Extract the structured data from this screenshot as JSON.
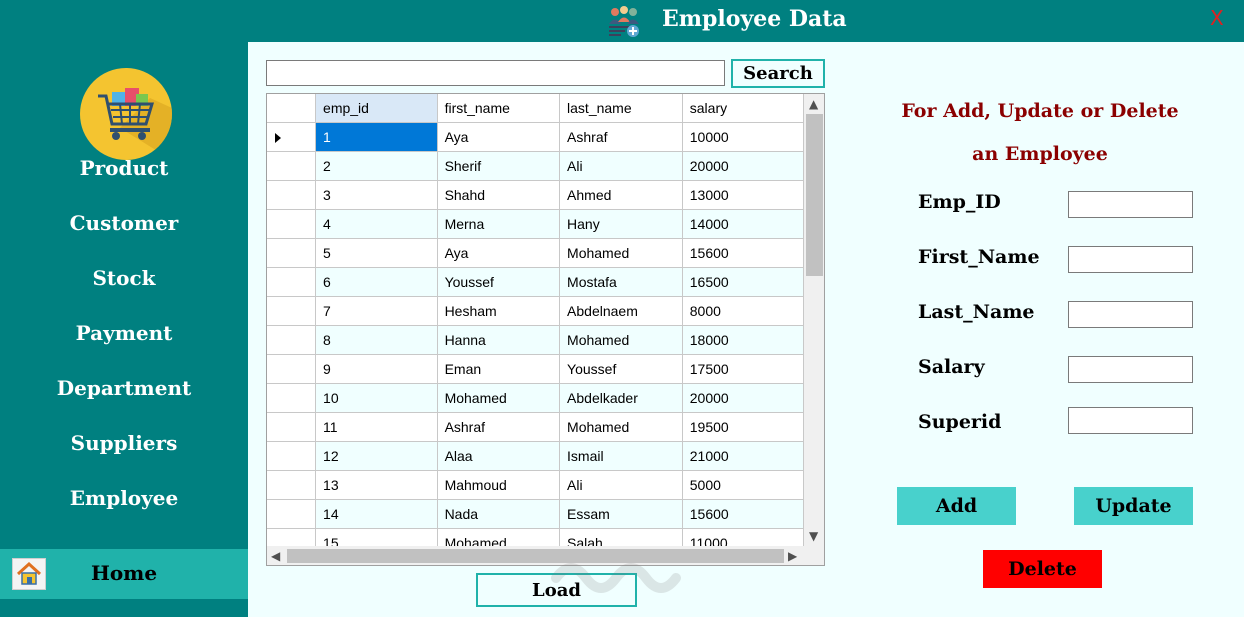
{
  "window": {
    "title": "Employee Data",
    "close_label": "X"
  },
  "sidebar": {
    "items": [
      {
        "label": "Product"
      },
      {
        "label": "Customer"
      },
      {
        "label": "Stock"
      },
      {
        "label": "Payment"
      },
      {
        "label": "Department"
      },
      {
        "label": "Suppliers"
      },
      {
        "label": "Employee"
      }
    ],
    "home_label": "Home"
  },
  "search": {
    "value": "",
    "button_label": "Search"
  },
  "grid": {
    "columns": [
      "emp_id",
      "first_name",
      "last_name",
      "salary"
    ],
    "rows": [
      [
        "1",
        "Aya",
        "Ashraf",
        "10000"
      ],
      [
        "2",
        "Sherif",
        "Ali",
        "20000"
      ],
      [
        "3",
        "Shahd",
        "Ahmed",
        "13000"
      ],
      [
        "4",
        "Merna",
        "Hany",
        "14000"
      ],
      [
        "5",
        "Aya",
        "Mohamed",
        "15600"
      ],
      [
        "6",
        "Youssef",
        "Mostafa",
        "16500"
      ],
      [
        "7",
        "Hesham",
        "Abdelnaem",
        "8000"
      ],
      [
        "8",
        "Hanna",
        "Mohamed",
        "18000"
      ],
      [
        "9",
        "Eman",
        "Youssef",
        "17500"
      ],
      [
        "10",
        "Mohamed",
        "Abdelkader",
        "20000"
      ],
      [
        "11",
        "Ashraf",
        "Mohamed",
        "19500"
      ],
      [
        "12",
        "Alaa",
        "Ismail",
        "21000"
      ],
      [
        "13",
        "Mahmoud",
        "Ali",
        "5000"
      ],
      [
        "14",
        "Nada",
        "Essam",
        "15600"
      ],
      [
        "15",
        "Mohamed",
        "Salah",
        "11000"
      ]
    ],
    "selected_row": 0
  },
  "load_label": "Load",
  "form": {
    "heading_line1": "For Add, Update or Delete",
    "heading_line2": "an Employee",
    "fields": [
      {
        "label": "Emp_ID",
        "value": ""
      },
      {
        "label": "First_Name",
        "value": ""
      },
      {
        "label": "Last_Name",
        "value": ""
      },
      {
        "label": "Salary",
        "value": ""
      },
      {
        "label": "Superid",
        "value": ""
      }
    ],
    "add_label": "Add",
    "update_label": "Update",
    "delete_label": "Delete"
  },
  "colors": {
    "primary": "#008080",
    "accent": "#20b2aa",
    "button": "#48d1cc",
    "danger": "#ff0000",
    "heading": "#8b0000",
    "selection": "#0078d7",
    "background": "#f0ffff"
  },
  "icons": [
    "employees-icon",
    "shopping-cart-logo",
    "home-icon"
  ]
}
